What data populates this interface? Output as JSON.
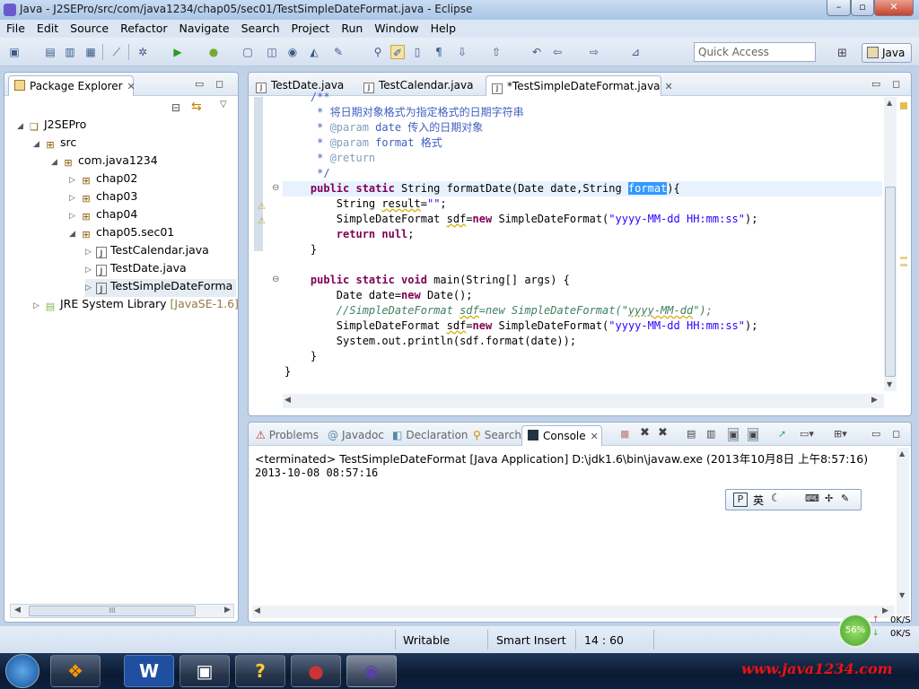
{
  "window": {
    "title": "Java - J2SEPro/src/com/java1234/chap05/sec01/TestSimpleDateFormat.java - Eclipse"
  },
  "menu": [
    "File",
    "Edit",
    "Source",
    "Refactor",
    "Navigate",
    "Search",
    "Project",
    "Run",
    "Window",
    "Help"
  ],
  "quick_access": {
    "placeholder": "Quick Access"
  },
  "perspective": {
    "label": "Java"
  },
  "package_explorer": {
    "title": "Package Explorer",
    "tree": [
      {
        "label": "J2SEPro",
        "suffix": ""
      },
      {
        "label": "src",
        "suffix": ""
      },
      {
        "label": "com.java1234",
        "suffix": ""
      },
      {
        "label": "chap02",
        "suffix": ""
      },
      {
        "label": "chap03",
        "suffix": ""
      },
      {
        "label": "chap04",
        "suffix": ""
      },
      {
        "label": "chap05.sec01",
        "suffix": ""
      },
      {
        "label": "TestCalendar.java",
        "suffix": ""
      },
      {
        "label": "TestDate.java",
        "suffix": ""
      },
      {
        "label": "TestSimpleDateForma",
        "suffix": ""
      },
      {
        "label": "JRE System Library",
        "suffix": "[JavaSE-1.6]"
      }
    ]
  },
  "editor": {
    "tabs": [
      "TestDate.java",
      "TestCalendar.java",
      "*TestSimpleDateFormat.java"
    ],
    "code": {
      "l1": "    /**",
      "l2a": "     * ",
      "l2b": "将日期对象格式为指定格式的日期字符串",
      "l3a": "     * ",
      "l3b": "@param",
      "l3c": " date ",
      "l3d": "传入的日期对象",
      "l4a": "     * ",
      "l4b": "@param",
      "l4c": " format ",
      "l4d": "格式",
      "l5a": "     * ",
      "l5b": "@return",
      "l6": "     */",
      "l7a": "    ",
      "l7b": "public static",
      "l7c": " String formatDate(Date date,String ",
      "l7d": "format",
      "l7e": "){",
      "l8a": "        String ",
      "l8b": "result",
      "l8c": "=",
      "l8d": "\"\"",
      "l8e": ";",
      "l9a": "        SimpleDateFormat ",
      "l9b": "sdf",
      "l9c": "=",
      "l9d": "new",
      "l9e": " SimpleDateFormat(",
      "l9f": "\"yyyy-MM-dd HH:mm:ss\"",
      "l9g": ");",
      "l10a": "        ",
      "l10b": "return null",
      "l10c": ";",
      "l11": "    }",
      "l12": "",
      "l13a": "    ",
      "l13b": "public static void",
      "l13c": " main(String[] args) {",
      "l14a": "        Date date=",
      "l14b": "new",
      "l14c": " Date();",
      "l15a": "        //SimpleDateFormat ",
      "l15b": "sdf",
      "l15c": "=new SimpleDateFormat(\"",
      "l15d": "yyyy-MM-dd",
      "l15e": "\");",
      "l16a": "        SimpleDateFormat ",
      "l16b": "sdf",
      "l16c": "=",
      "l16d": "new",
      "l16e": " SimpleDateFormat(",
      "l16f": "\"yyyy-MM-dd HH:mm:ss\"",
      "l16g": ");",
      "l17": "        System.out.println(sdf.format(date));",
      "l18": "    }",
      "l19": "}"
    }
  },
  "console": {
    "tabs": [
      "Problems",
      "Javadoc",
      "Declaration",
      "Search",
      "Console"
    ],
    "header": "<terminated> TestSimpleDateFormat [Java Application] D:\\jdk1.6\\bin\\javaw.exe (2013年10月8日 上午8:57:16)",
    "output": "2013-10-08 08:57:16"
  },
  "ime": {
    "label": "英"
  },
  "status": {
    "writable": "Writable",
    "insert": "Smart Insert",
    "position": "14 : 60"
  },
  "network": {
    "percent": "56%",
    "up": "0K/S",
    "down": "0K/S"
  },
  "watermark": "www.java1234.com",
  "taskbar": [
    "W"
  ]
}
